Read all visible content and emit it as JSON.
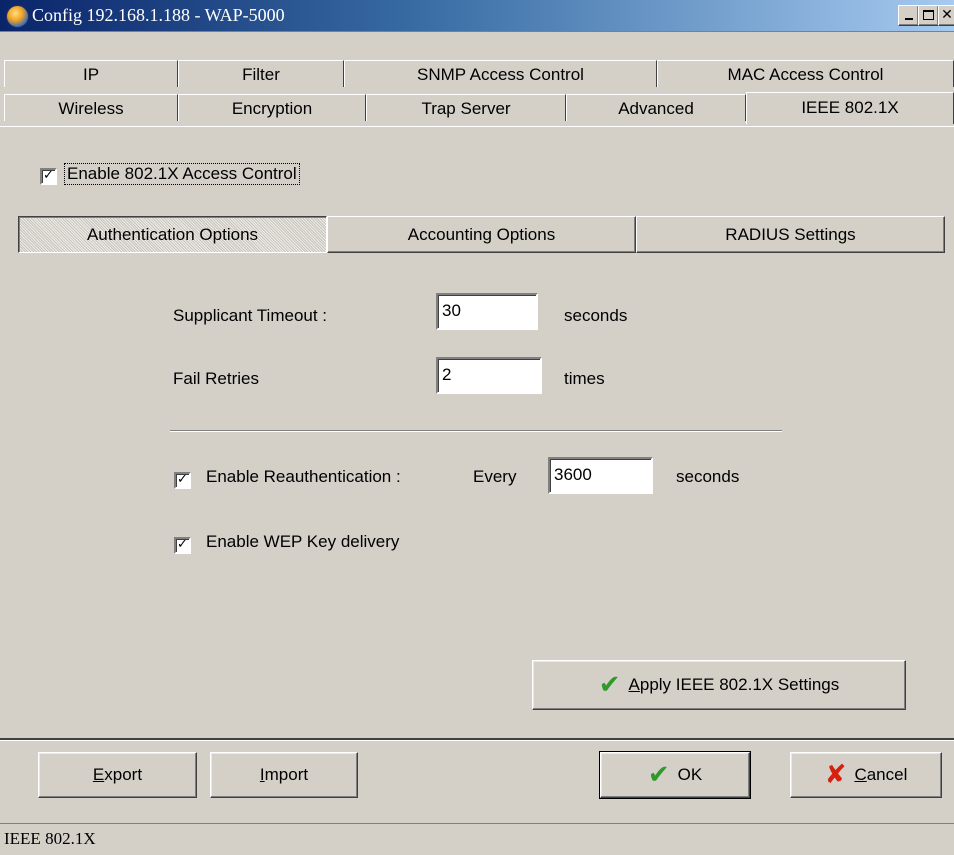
{
  "window": {
    "title": "Config 192.168.1.188 - WAP-5000",
    "close_glyph": "✕"
  },
  "tabs_row1": [
    "IP",
    "Filter",
    "SNMP Access Control",
    "MAC Access Control"
  ],
  "tabs_row2": [
    "Wireless",
    "Encryption",
    "Trap Server",
    "Advanced",
    "IEEE 802.1X"
  ],
  "active_tab": "IEEE 802.1X",
  "enable_8021x": {
    "label": "Enable 802.1X Access Control",
    "checked": true,
    "mark": "✓"
  },
  "option_buttons": {
    "authentication": "Authentication Options",
    "accounting": "Accounting Options",
    "radius": "RADIUS Settings",
    "selected": "Authentication Options"
  },
  "supplicant_timeout": {
    "label": "Supplicant Timeout :",
    "value": "30",
    "unit": "seconds"
  },
  "fail_retries": {
    "label": "Fail Retries",
    "value": "2",
    "unit": "times"
  },
  "reauth": {
    "label": "Enable Reauthentication :",
    "checked": true,
    "mark": "✓",
    "every_label": "Every",
    "value": "3600",
    "unit": "seconds"
  },
  "wep_delivery": {
    "label": "Enable WEP Key delivery",
    "checked": true,
    "mark": "✓"
  },
  "apply_button": {
    "accel": "A",
    "label_rest": "pply IEEE 802.1X Settings",
    "icon": "✔"
  },
  "footer": {
    "export": {
      "accel": "E",
      "rest": "xport"
    },
    "import": {
      "accel": "I",
      "rest": "mport"
    },
    "ok": {
      "label": "OK",
      "icon": "✔"
    },
    "cancel": {
      "accel": "C",
      "rest": "ancel",
      "icon": "✘"
    }
  },
  "status_bar": "IEEE 802.1X",
  "colors": {
    "title_gradient_start": "#0a246a",
    "title_gradient_end": "#a6caf0",
    "face": "#d4d0c8",
    "ok_icon": "#2f9a2a",
    "cancel_icon": "#d82010"
  }
}
